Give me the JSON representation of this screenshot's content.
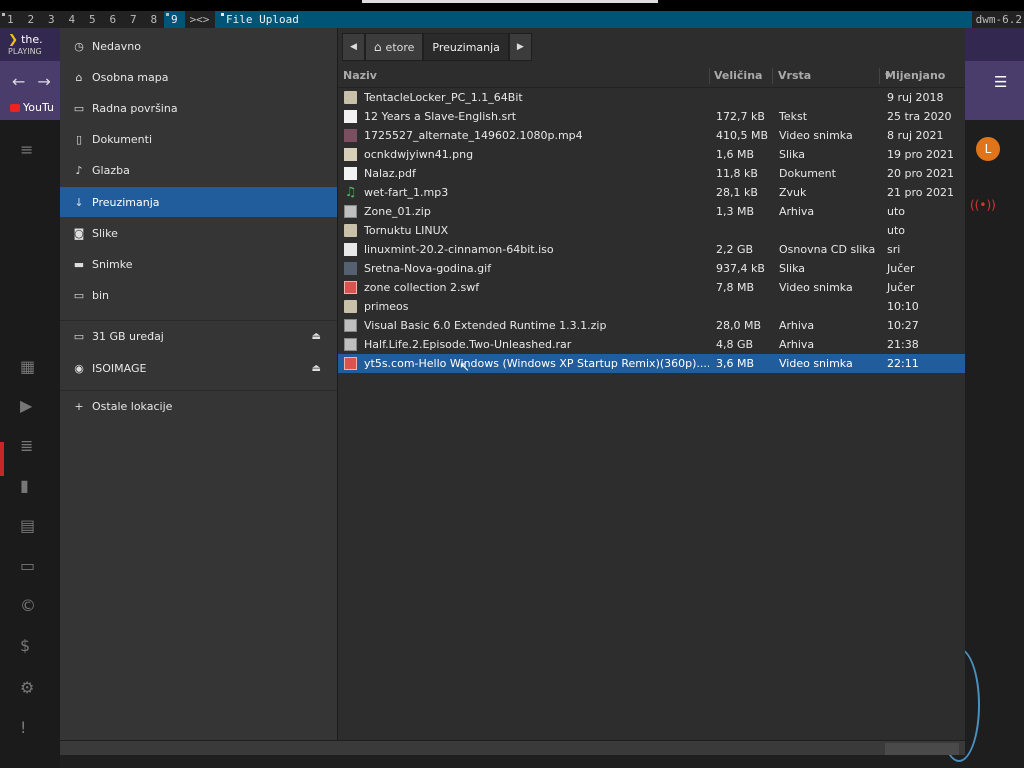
{
  "dwm": {
    "tags": [
      "1",
      "2",
      "3",
      "4",
      "5",
      "6",
      "7",
      "8",
      "9"
    ],
    "layout": "><>",
    "title": "File Upload",
    "status": "dwm-6.2"
  },
  "background_app": {
    "now_playing": "the.",
    "now_playing_sub": "PLAYING",
    "tab_label": "YouTu",
    "avatar_letter": "L"
  },
  "dialog": {
    "sidebar": [
      {
        "icon": "clock-icon",
        "glyph": "◷",
        "label": "Nedavno"
      },
      {
        "icon": "home-icon",
        "glyph": "⌂",
        "label": "Osobna mapa"
      },
      {
        "icon": "folder-icon",
        "glyph": "▭",
        "label": "Radna površina"
      },
      {
        "icon": "document-icon",
        "glyph": "▯",
        "label": "Dokumenti"
      },
      {
        "icon": "music-icon",
        "glyph": "♪",
        "label": "Glazba"
      },
      {
        "icon": "download-icon",
        "glyph": "↓",
        "label": "Preuzimanja",
        "selected": true
      },
      {
        "icon": "camera-icon",
        "glyph": "◙",
        "label": "Slike"
      },
      {
        "icon": "video-icon",
        "glyph": "▬",
        "label": "Snimke"
      },
      {
        "icon": "folder-icon",
        "glyph": "▭",
        "label": "bin"
      }
    ],
    "devices": [
      {
        "icon": "drive-icon",
        "glyph": "▭",
        "label": "31 GB uređaj"
      },
      {
        "icon": "disc-icon",
        "glyph": "◉",
        "label": "ISOIMAGE"
      }
    ],
    "other_locations": {
      "glyph": "+",
      "label": "Ostale lokacije"
    },
    "path": {
      "home_label": "etore",
      "current": "Preuzimanja"
    },
    "columns": {
      "name": "Naziv",
      "size": "Veličina",
      "type": "Vrsta",
      "modified": "Mijenjano"
    },
    "files": [
      {
        "kind": "folder",
        "name": "TentacleLocker_PC_1.1_64Bit",
        "size": "",
        "type": "",
        "date": "9 ruj 2018"
      },
      {
        "kind": "doc",
        "name": "12 Years a Slave-English.srt",
        "size": "172,7 kB",
        "type": "Tekst",
        "date": "25 tra 2020"
      },
      {
        "kind": "film",
        "name": "1725527_alternate_149602.1080p.mp4",
        "size": "410,5 MB",
        "type": "Video snimka",
        "date": "8 ruj 2021"
      },
      {
        "kind": "image",
        "name": "ocnkdwjyiwn41.png",
        "size": "1,6 MB",
        "type": "Slika",
        "date": "19 pro 2021"
      },
      {
        "kind": "doc",
        "name": "Nalaz.pdf",
        "size": "11,8 kB",
        "type": "Dokument",
        "date": "20 pro 2021"
      },
      {
        "kind": "audio",
        "name": "wet-fart_1.mp3",
        "size": "28,1 kB",
        "type": "Zvuk",
        "date": "21 pro 2021"
      },
      {
        "kind": "zip",
        "name": "Zone_01.zip",
        "size": "1,3 MB",
        "type": "Arhiva",
        "date": "uto"
      },
      {
        "kind": "folder",
        "name": "Tornuktu LINUX",
        "size": "",
        "type": "",
        "date": "uto"
      },
      {
        "kind": "disc",
        "name": "linuxmint-20.2-cinnamon-64bit.iso",
        "size": "2,2 GB",
        "type": "Osnovna CD slika",
        "date": "sri"
      },
      {
        "kind": "gif",
        "name": "Sretna-Nova-godina.gif",
        "size": "937,4 kB",
        "type": "Slika",
        "date": "Jučer"
      },
      {
        "kind": "video",
        "name": "zone collection 2.swf",
        "size": "7,8 MB",
        "type": "Video snimka",
        "date": "Jučer"
      },
      {
        "kind": "folder",
        "name": "primeos",
        "size": "",
        "type": "",
        "date": "10:10"
      },
      {
        "kind": "zip",
        "name": "Visual Basic 6.0 Extended Runtime 1.3.1.zip",
        "size": "28,0 MB",
        "type": "Arhiva",
        "date": "10:27"
      },
      {
        "kind": "zip",
        "name": "Half.Life.2.Episode.Two-Unleashed.rar",
        "size": "4,8 GB",
        "type": "Arhiva",
        "date": "21:38"
      },
      {
        "kind": "video",
        "name": "yt5s.com-Hello Windows (Windows XP Startup Remix)(360p)....",
        "size": "3,6 MB",
        "type": "Video snimka",
        "date": "22:11",
        "selected": true
      }
    ],
    "colors": {
      "selection": "#215d9c",
      "dwm_accent": "#005577"
    }
  }
}
